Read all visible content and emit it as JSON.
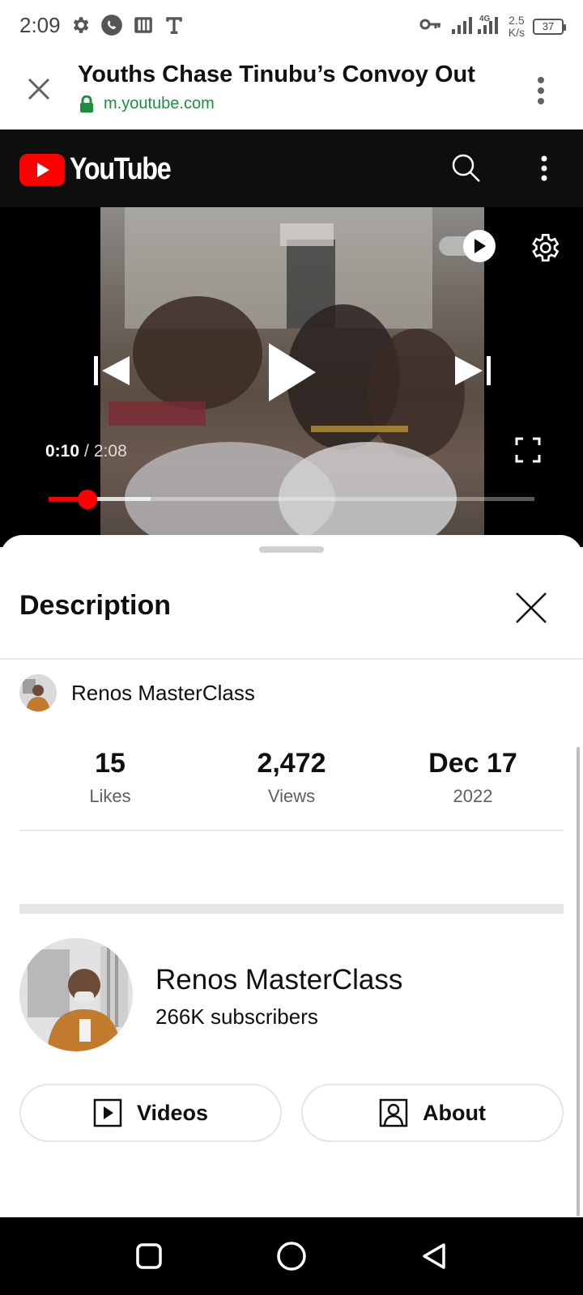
{
  "status_bar": {
    "time": "2:09",
    "network_type": "4G",
    "net_speed_value": "2.5",
    "net_speed_unit": "K/s",
    "battery": "37"
  },
  "tab": {
    "title": "Youths Chase Tinubu’s Convoy Out",
    "url": "m.youtube.com"
  },
  "youtube": {
    "logo_text": "YouTube"
  },
  "player": {
    "current_time": "0:10",
    "separator": "/",
    "duration": "2:08",
    "progress_fraction": 0.08,
    "buffered_fraction": 0.21,
    "autoplay_on": true
  },
  "description": {
    "title": "Description",
    "channel_name": "Renos MasterClass",
    "stats": [
      {
        "value": "15",
        "label": "Likes"
      },
      {
        "value": "2,472",
        "label": "Views"
      },
      {
        "value": "Dec 17",
        "label": "2022"
      }
    ],
    "channel": {
      "name": "Renos MasterClass",
      "subscribers": "266K subscribers"
    },
    "buttons": {
      "videos": "Videos",
      "about": "About"
    }
  },
  "colors": {
    "youtube_red": "#ff0000",
    "header_bg": "#0f0f0f",
    "secure_green": "#1e8e3e"
  },
  "icons": [
    "settings-icon",
    "whatsapp-icon",
    "parking-icon",
    "text-icon",
    "key-icon",
    "signal-icon",
    "close-icon",
    "lock-icon",
    "more-vert-icon",
    "youtube-play-icon",
    "search-icon",
    "autoplay-icon",
    "gear-icon",
    "skip-previous-icon",
    "play-icon",
    "skip-next-icon",
    "fullscreen-icon",
    "video-icon",
    "account-box-icon",
    "nav-square-icon",
    "nav-circle-icon",
    "nav-back-icon"
  ]
}
